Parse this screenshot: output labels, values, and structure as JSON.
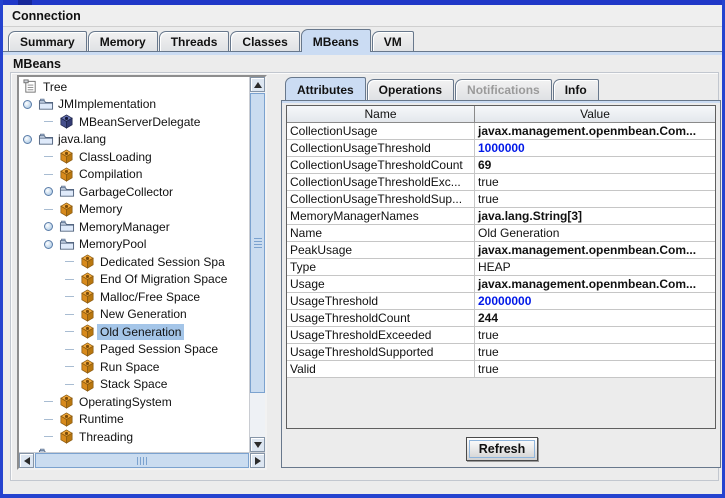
{
  "window": {
    "menu_label": "Connection",
    "section_label": "MBeans"
  },
  "colors": {
    "titlebar_blue": "#2038c8",
    "window_border_blue": "#2543cf",
    "tab_selected_blue": "#cbdcf3",
    "tree_selection_blue": "#a4c5e8",
    "editable_value_blue": "#0018e8"
  },
  "main_tabs": [
    {
      "label": "Summary",
      "state": ""
    },
    {
      "label": "Memory",
      "state": ""
    },
    {
      "label": "Threads",
      "state": ""
    },
    {
      "label": "Classes",
      "state": ""
    },
    {
      "label": "MBeans",
      "state": "selected"
    },
    {
      "label": "VM",
      "state": ""
    }
  ],
  "tree": {
    "root_label": "Tree",
    "items": [
      {
        "label": "Tree",
        "depth": 0,
        "icon": "tree",
        "handle": "none",
        "state": ""
      },
      {
        "label": "JMImplementation",
        "depth": 1,
        "icon": "folder",
        "handle": "expanded",
        "state": ""
      },
      {
        "label": "MBeanServerDelegate",
        "depth": 2,
        "icon": "bean-navy",
        "handle": "leaf",
        "state": ""
      },
      {
        "label": "java.lang",
        "depth": 1,
        "icon": "folder",
        "handle": "expanded",
        "state": ""
      },
      {
        "label": "ClassLoading",
        "depth": 2,
        "icon": "bean",
        "handle": "leaf",
        "state": ""
      },
      {
        "label": "Compilation",
        "depth": 2,
        "icon": "bean",
        "handle": "leaf",
        "state": ""
      },
      {
        "label": "GarbageCollector",
        "depth": 2,
        "icon": "folder",
        "handle": "collapsed",
        "state": ""
      },
      {
        "label": "Memory",
        "depth": 2,
        "icon": "bean",
        "handle": "leaf",
        "state": ""
      },
      {
        "label": "MemoryManager",
        "depth": 2,
        "icon": "folder",
        "handle": "collapsed",
        "state": ""
      },
      {
        "label": "MemoryPool",
        "depth": 2,
        "icon": "folder",
        "handle": "expanded",
        "state": ""
      },
      {
        "label": "Dedicated Session Spa",
        "depth": 3,
        "icon": "bean",
        "handle": "leaf",
        "state": ""
      },
      {
        "label": "End Of Migration Space",
        "depth": 3,
        "icon": "bean",
        "handle": "leaf",
        "state": ""
      },
      {
        "label": "Malloc/Free Space",
        "depth": 3,
        "icon": "bean",
        "handle": "leaf",
        "state": ""
      },
      {
        "label": "New Generation",
        "depth": 3,
        "icon": "bean",
        "handle": "leaf",
        "state": ""
      },
      {
        "label": "Old Generation",
        "depth": 3,
        "icon": "bean",
        "handle": "leaf",
        "state": "selected"
      },
      {
        "label": "Paged Session Space",
        "depth": 3,
        "icon": "bean",
        "handle": "leaf",
        "state": ""
      },
      {
        "label": "Run Space",
        "depth": 3,
        "icon": "bean",
        "handle": "leaf",
        "state": ""
      },
      {
        "label": "Stack Space",
        "depth": 3,
        "icon": "bean",
        "handle": "leaf",
        "state": ""
      },
      {
        "label": "OperatingSystem",
        "depth": 2,
        "icon": "bean",
        "handle": "leaf",
        "state": ""
      },
      {
        "label": "Runtime",
        "depth": 2,
        "icon": "bean",
        "handle": "leaf",
        "state": ""
      },
      {
        "label": "Threading",
        "depth": 2,
        "icon": "bean",
        "handle": "leaf",
        "state": ""
      },
      {
        "label": "",
        "depth": 1,
        "icon": "folder",
        "handle": "leaf",
        "state": ""
      }
    ]
  },
  "detail_tabs": [
    {
      "label": "Attributes",
      "state": "selected"
    },
    {
      "label": "Operations",
      "state": ""
    },
    {
      "label": "Notifications",
      "state": "disabled"
    },
    {
      "label": "Info",
      "state": ""
    }
  ],
  "attributes_table": {
    "columns": [
      "Name",
      "Value"
    ],
    "rows": [
      {
        "name": "CollectionUsage",
        "value": "javax.management.openmbean.Com...",
        "vstyle": "b"
      },
      {
        "name": "CollectionUsageThreshold",
        "value": "1000000",
        "vstyle": "bb"
      },
      {
        "name": "CollectionUsageThresholdCount",
        "value": "69",
        "vstyle": "b"
      },
      {
        "name": "CollectionUsageThresholdExc...",
        "value": "true",
        "vstyle": ""
      },
      {
        "name": "CollectionUsageThresholdSup...",
        "value": "true",
        "vstyle": ""
      },
      {
        "name": "MemoryManagerNames",
        "value": "java.lang.String[3]",
        "vstyle": "b"
      },
      {
        "name": "Name",
        "value": "Old Generation",
        "vstyle": ""
      },
      {
        "name": "PeakUsage",
        "value": "javax.management.openmbean.Com...",
        "vstyle": "b"
      },
      {
        "name": "Type",
        "value": "HEAP",
        "vstyle": ""
      },
      {
        "name": "Usage",
        "value": "javax.management.openmbean.Com...",
        "vstyle": "b"
      },
      {
        "name": "UsageThreshold",
        "value": "20000000",
        "vstyle": "bb"
      },
      {
        "name": "UsageThresholdCount",
        "value": "244",
        "vstyle": "b"
      },
      {
        "name": "UsageThresholdExceeded",
        "value": "true",
        "vstyle": ""
      },
      {
        "name": "UsageThresholdSupported",
        "value": "true",
        "vstyle": ""
      },
      {
        "name": "Valid",
        "value": "true",
        "vstyle": ""
      }
    ]
  },
  "refresh_button": {
    "label": "Refresh"
  }
}
